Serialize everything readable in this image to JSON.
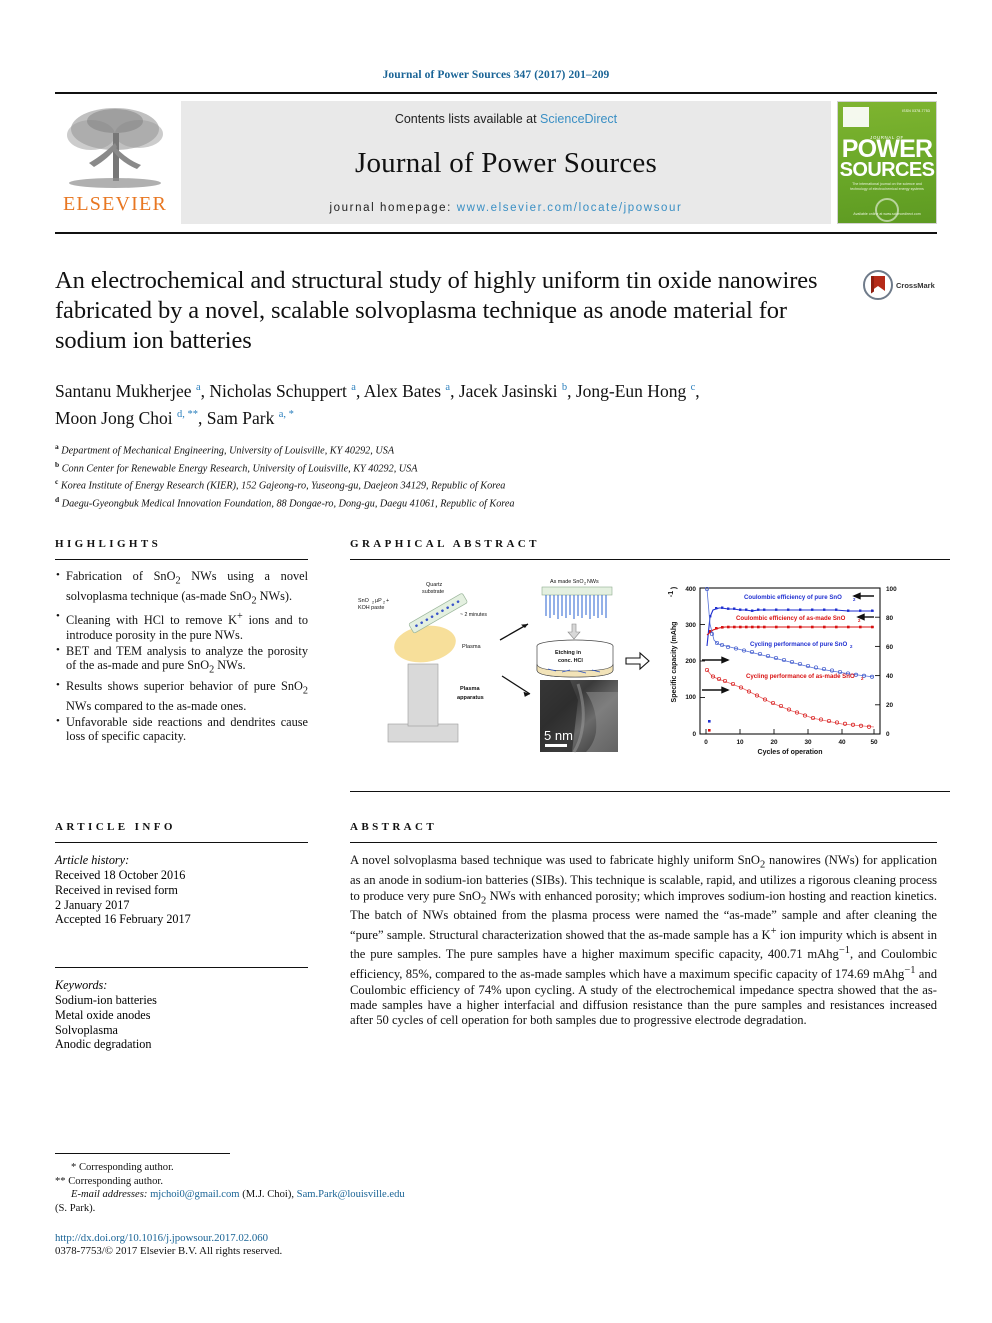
{
  "running_head": "Journal of Power Sources 347 (2017) 201–209",
  "masthead": {
    "contents_prefix": "Contents lists available at ",
    "contents_link": "ScienceDirect",
    "journal_title": "Journal of Power Sources",
    "homepage_label": "journal homepage: ",
    "homepage_url": "www.elsevier.com/locate/jpowsour",
    "publisher": "ELSEVIER",
    "cover": {
      "issn_top": "ISSN 0378-7753",
      "small_top": "JOURNAL OF",
      "line1": "POWER",
      "line2": "SOURCES",
      "subtitle": "The international journal on the science and technology of electrochemical energy systems",
      "bottom": "Available online at www.sciencedirect.com"
    },
    "crossmark_label": "CrossMark"
  },
  "article": {
    "title": "An electrochemical and structural study of highly uniform tin oxide nanowires fabricated by a novel, scalable solvoplasma technique as anode material for sodium ion batteries",
    "authors_line1": "Santanu Mukherjee <sup>a</sup>, Nicholas Schuppert <sup>a</sup>, Alex Bates <sup>a</sup>, Jacek Jasinski <sup>b</sup>, Jong-Eun Hong <sup>c</sup>,",
    "authors_line2": "Moon Jong Choi <sup>d, **</sup>, Sam Park <sup>a, *</sup>",
    "affiliations": [
      {
        "marker": "a",
        "text": "Department of Mechanical Engineering, University of Louisville, KY 40292, USA"
      },
      {
        "marker": "b",
        "text": "Conn Center for Renewable Energy Research, University of Louisville, KY 40292, USA"
      },
      {
        "marker": "c",
        "text": "Korea Institute of Energy Research (KIER), 152 Gajeong-ro, Yuseong-gu, Daejeon 34129, Republic of Korea"
      },
      {
        "marker": "d",
        "text": "Daegu-Gyeongbuk Medical Innovation Foundation, 88 Dongae-ro, Dong-gu, Daegu 41061, Republic of Korea"
      }
    ]
  },
  "highlights": {
    "heading": "HIGHLIGHTS",
    "items": [
      "Fabrication of SnO<sub>2</sub> NWs using a novel solvoplasma technique (as-made SnO<sub>2</sub> NWs).",
      "Cleaning with HCl to remove K<sup>+</sup> ions and to introduce porosity in the pure NWs.",
      "BET and TEM analysis to analyze the porosity of the as-made and pure SnO<sub>2</sub> NWs.",
      "Results shows superior behavior of pure SnO<sub>2</sub> NWs compared to the as-made ones.",
      "Unfavorable side reactions and dendrites cause loss of specific capacity."
    ]
  },
  "graphical_abstract": {
    "heading": "GRAPHICAL ABSTRACT",
    "labels": {
      "paste": "SnO₂ μP₂ + KOH paste",
      "quartz": "Quartz substrate",
      "duration": "~ 2 minutes",
      "plasma": "Plasma",
      "apparatus": "Plasma apparatus",
      "as_made": "As made SnO₂ NWs",
      "etching": "Etching in conc. HCl",
      "scale_bar": "5 nm"
    }
  },
  "chart_data": {
    "type": "line",
    "title": "",
    "xlabel": "Cycles of operation",
    "ylabel": "Specific capacity (mAhg⁻¹)",
    "y2label": "",
    "xlim": [
      0,
      50
    ],
    "ylim": [
      0,
      400
    ],
    "y2lim": [
      0,
      100
    ],
    "xticks": [
      0,
      10,
      20,
      30,
      40,
      50
    ],
    "yticks": [
      0,
      100,
      200,
      300,
      400
    ],
    "y2ticks": [
      0,
      20,
      40,
      60,
      80,
      100
    ],
    "grid": false,
    "legend": "inline-annotations",
    "annotations": [
      "Coulombic efficiency of pure SnO₂",
      "Coulombic efficiency of as-made SnO₂",
      "Cycling performance of pure SnO₂",
      "Cycling performance of as-made SnO₂"
    ],
    "series": [
      {
        "name": "Coulombic efficiency of pure SnO2",
        "axis": "right",
        "color": "#1f2fd0",
        "x": [
          1,
          2,
          3,
          4,
          5,
          6,
          8,
          10,
          12,
          14,
          16,
          18,
          20,
          24,
          28,
          32,
          36,
          40,
          44,
          48,
          50
        ],
        "values": [
          60,
          80,
          86,
          87,
          88,
          88,
          87,
          87,
          86,
          86,
          85,
          86,
          86,
          86,
          86,
          86,
          86,
          86,
          86,
          85,
          85
        ]
      },
      {
        "name": "Coulombic efficiency of as-made SnO2",
        "axis": "right",
        "color": "#d81212",
        "x": [
          1,
          2,
          3,
          4,
          5,
          6,
          8,
          10,
          12,
          14,
          16,
          18,
          20,
          24,
          28,
          32,
          36,
          40,
          44,
          48,
          50
        ],
        "values": [
          68,
          72,
          74,
          75,
          75,
          75,
          75,
          75,
          75,
          75,
          75,
          75,
          75,
          75,
          75,
          75,
          75,
          75,
          75,
          75,
          75
        ]
      },
      {
        "name": "Cycling performance of pure SnO2",
        "axis": "left",
        "color": "#1f2fd0",
        "x": [
          1,
          2,
          3,
          4,
          5,
          6,
          8,
          10,
          14,
          18,
          22,
          26,
          30,
          34,
          38,
          42,
          46,
          50
        ],
        "values": [
          400,
          300,
          260,
          250,
          248,
          245,
          240,
          235,
          228,
          222,
          215,
          208,
          202,
          198,
          194,
          190,
          188,
          185
        ]
      },
      {
        "name": "Cycling performance of as-made SnO2",
        "axis": "left",
        "color": "#d81212",
        "x": [
          1,
          2,
          3,
          4,
          5,
          6,
          8,
          10,
          14,
          18,
          22,
          26,
          30,
          34,
          38,
          42,
          46,
          50
        ],
        "values": [
          175,
          160,
          155,
          152,
          150,
          148,
          142,
          136,
          125,
          112,
          100,
          92,
          82,
          74,
          66,
          58,
          52,
          45
        ]
      }
    ]
  },
  "article_info": {
    "heading": "ARTICLE INFO",
    "history_label": "Article history:",
    "history": [
      "Received 18 October 2016",
      "Received in revised form",
      "2 January 2017",
      "Accepted 16 February 2017"
    ],
    "keywords_label": "Keywords:",
    "keywords": [
      "Sodium-ion batteries",
      "Metal oxide anodes",
      "Solvoplasma",
      "Anodic degradation"
    ]
  },
  "abstract": {
    "heading": "ABSTRACT",
    "text": "A novel solvoplasma based technique was used to fabricate highly uniform SnO<sub>2</sub> nanowires (NWs) for application as an anode in sodium-ion batteries (SIBs). This technique is scalable, rapid, and utilizes a rigorous cleaning process to produce very pure SnO<sub>2</sub> NWs with enhanced porosity; which improves sodium-ion hosting and reaction kinetics. The batch of NWs obtained from the plasma process were named the “as-made” sample and after cleaning the “pure” sample. Structural characterization showed that the as-made sample has a K<sup>+</sup> ion impurity which is absent in the pure samples. The pure samples have a higher maximum specific capacity, 400.71 mAhg<sup>−1</sup>, and Coulombic efficiency, 85%, compared to the as-made samples which have a maximum specific capacity of 174.69 mAhg<sup>−1</sup> and Coulombic efficiency of 74% upon cycling. A study of the electrochemical impedance spectra showed that the as-made samples have a higher interfacial and diffusion resistance than the pure samples and resistances increased after 50 cycles of cell operation for both samples due to progressive electrode degradation."
  },
  "footer": {
    "corresponding_1": "* Corresponding author.",
    "corresponding_2": "** Corresponding author.",
    "email_label": "E-mail addresses:",
    "email_1": "mjchoi0@gmail.com",
    "email_1_owner": "(M.J. Choi),",
    "email_2": "Sam.Park@louisville.edu",
    "email_2_owner": "(S. Park).",
    "doi": "http://dx.doi.org/10.1016/j.jpowsour.2017.02.060",
    "copyright": "0378-7753/© 2017 Elsevier B.V. All rights reserved."
  },
  "colors": {
    "link": "#1a6496",
    "science_direct": "#3a8fc4",
    "elsevier_orange": "#e87722",
    "cover_green": "#6aa828",
    "blue_series": "#1f2fd0",
    "red_series": "#d81212"
  }
}
